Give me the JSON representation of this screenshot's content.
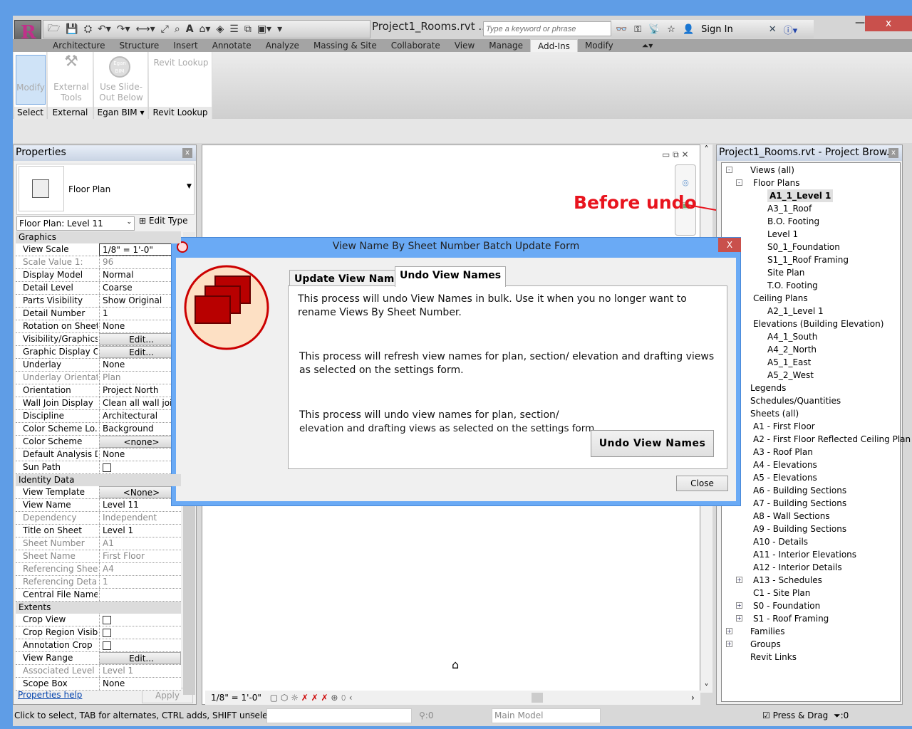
{
  "app": {
    "title": "Project1_Rooms.rvt ...",
    "search_placeholder": "Type a keyword or phrase",
    "sign_in": "Sign In",
    "close": "x"
  },
  "tabs": [
    "Architecture",
    "Structure",
    "Insert",
    "Annotate",
    "Analyze",
    "Massing & Site",
    "Collaborate",
    "View",
    "Manage",
    "Add-Ins",
    "Modify"
  ],
  "ribbon": {
    "modify": "Modify",
    "external_tools": "External Tools",
    "egan_icon": "Egan BIM",
    "use_slide": "Use Slide-Out Below",
    "revit_lookup": "Revit Lookup",
    "panels": [
      "Select",
      "External",
      "Egan BIM",
      "Revit Lookup"
    ]
  },
  "properties": {
    "title": "Properties",
    "type_name": "Floor Plan",
    "instance": "Floor Plan: Level 11",
    "edit_type": "Edit Type",
    "help": "Properties help",
    "apply": "Apply",
    "sections": {
      "graphics": "Graphics",
      "identity": "Identity Data",
      "extents": "Extents"
    },
    "graphics": [
      {
        "label": "View Scale",
        "value": "1/8\" = 1'-0\"",
        "kind": "input"
      },
      {
        "label": "Scale Value    1:",
        "value": "96",
        "gray": true
      },
      {
        "label": "Display Model",
        "value": "Normal"
      },
      {
        "label": "Detail Level",
        "value": "Coarse"
      },
      {
        "label": "Parts Visibility",
        "value": "Show Original"
      },
      {
        "label": "Detail Number",
        "value": "1"
      },
      {
        "label": "Rotation on Sheet",
        "value": "None"
      },
      {
        "label": "Visibility/Graphics...",
        "value": "Edit...",
        "kind": "button"
      },
      {
        "label": "Graphic Display O...",
        "value": "Edit...",
        "kind": "button"
      },
      {
        "label": "Underlay",
        "value": "None"
      },
      {
        "label": "Underlay Orientat...",
        "value": "Plan",
        "gray": true
      },
      {
        "label": "Orientation",
        "value": "Project North"
      },
      {
        "label": "Wall Join Display",
        "value": "Clean all wall joi..."
      },
      {
        "label": "Discipline",
        "value": "Architectural"
      },
      {
        "label": "Color Scheme Lo...",
        "value": "Background"
      },
      {
        "label": "Color Scheme",
        "value": "<none>",
        "kind": "button"
      },
      {
        "label": "Default Analysis D...",
        "value": "None"
      },
      {
        "label": "Sun Path",
        "value": "",
        "kind": "check"
      }
    ],
    "identity": [
      {
        "label": "View Template",
        "value": "<None>",
        "kind": "button"
      },
      {
        "label": "View Name",
        "value": "Level 11"
      },
      {
        "label": "Dependency",
        "value": "Independent",
        "gray": true
      },
      {
        "label": "Title on Sheet",
        "value": "Level 1"
      },
      {
        "label": "Sheet Number",
        "value": "A1",
        "gray": true
      },
      {
        "label": "Sheet Name",
        "value": "First Floor",
        "gray": true
      },
      {
        "label": "Referencing Sheet",
        "value": "A4",
        "gray": true
      },
      {
        "label": "Referencing Detail",
        "value": "1",
        "gray": true
      },
      {
        "label": "Central File Name",
        "value": ""
      }
    ],
    "extents": [
      {
        "label": "Crop View",
        "value": "",
        "kind": "check"
      },
      {
        "label": "Crop Region Visible",
        "value": "",
        "kind": "check"
      },
      {
        "label": "Annotation Crop",
        "value": "",
        "kind": "check"
      },
      {
        "label": "View Range",
        "value": "Edit...",
        "kind": "button"
      },
      {
        "label": "Associated Level",
        "value": "Level 1",
        "gray": true
      },
      {
        "label": "Scope Box",
        "value": "None"
      }
    ]
  },
  "canvas": {
    "scale": "1/8\" = 1'-0\"",
    "annotation": "Before undo"
  },
  "browser": {
    "title": "Project1_Rooms.rvt - Project Brow...",
    "items": [
      {
        "t": "Views (all)",
        "lvl": 0,
        "exp": "-"
      },
      {
        "t": "Floor Plans",
        "lvl": 1,
        "exp": "-"
      },
      {
        "t": "A1_1_Level 1",
        "lvl": 2,
        "sel": true
      },
      {
        "t": "A3_1_Roof",
        "lvl": 2
      },
      {
        "t": "B.O. Footing",
        "lvl": 2
      },
      {
        "t": "Level 1",
        "lvl": 2
      },
      {
        "t": "S0_1_Foundation",
        "lvl": 2
      },
      {
        "t": "S1_1_Roof Framing",
        "lvl": 2
      },
      {
        "t": "Site Plan",
        "lvl": 2
      },
      {
        "t": "T.O. Footing",
        "lvl": 2
      },
      {
        "t": "Ceiling Plans",
        "lvl": 1
      },
      {
        "t": "A2_1_Level 1",
        "lvl": 2
      },
      {
        "t": "Elevations (Building Elevation)",
        "lvl": 1
      },
      {
        "t": "A4_1_South",
        "lvl": 2
      },
      {
        "t": "A4_2_North",
        "lvl": 2
      },
      {
        "t": "A5_1_East",
        "lvl": 2
      },
      {
        "t": "A5_2_West",
        "lvl": 2
      },
      {
        "t": "Legends",
        "lvl": 0.5
      },
      {
        "t": "Schedules/Quantities",
        "lvl": 0.5
      },
      {
        "t": "Sheets (all)",
        "lvl": 0.5
      },
      {
        "t": "A1 - First Floor",
        "lvl": 1
      },
      {
        "t": "A2 - First Floor Reflected Ceiling Plan",
        "lvl": 1
      },
      {
        "t": "A3 - Roof Plan",
        "lvl": 1
      },
      {
        "t": "A4 - Elevations",
        "lvl": 1
      },
      {
        "t": "A5 - Elevations",
        "lvl": 1
      },
      {
        "t": "A6 - Building Sections",
        "lvl": 1
      },
      {
        "t": "A7 - Building Sections",
        "lvl": 1
      },
      {
        "t": "A8 - Wall Sections",
        "lvl": 1
      },
      {
        "t": "A9 - Building Sections",
        "lvl": 1
      },
      {
        "t": "A10 - Details",
        "lvl": 1
      },
      {
        "t": "A11 - Interior Elevations",
        "lvl": 1
      },
      {
        "t": "A12 - Interior Details",
        "lvl": 1
      },
      {
        "t": "A13 - Schedules",
        "lvl": 1,
        "exp": "+"
      },
      {
        "t": "C1 - Site Plan",
        "lvl": 1
      },
      {
        "t": "S0 - Foundation",
        "lvl": 1,
        "exp": "+"
      },
      {
        "t": "S1 - Roof Framing",
        "lvl": 1,
        "exp": "+"
      },
      {
        "t": "Families",
        "lvl": 0,
        "exp": "+"
      },
      {
        "t": "Groups",
        "lvl": 0,
        "exp": "+"
      },
      {
        "t": "Revit Links",
        "lvl": 0
      }
    ]
  },
  "dialog": {
    "title": "View Name By Sheet Number Batch Update Form",
    "close": "X",
    "tabs": [
      "Update View Names",
      "Undo View Names"
    ],
    "p1": "This process will undo View Names in bulk.  Use it when you no longer want to rename Views By Sheet Number.",
    "p2": "This process will refresh view names for plan, section/ elevation and drafting views as selected on the settings form.",
    "p3a": "This process will undo view names for plan, section/",
    "p3b": "elevation and drafting views as selected on the settings form.",
    "undo_button": "Undo View Names",
    "close_button": "Close"
  },
  "status": {
    "hint": "Click to select, TAB for alternates, CTRL adds, SHIFT unselects",
    "count": ":0",
    "model": "Main Model",
    "press_drag": "Press & Drag",
    "filter_count": ":0"
  },
  "colors": {
    "annotation": "#e8141e",
    "dialog_icon": "#b80000"
  }
}
